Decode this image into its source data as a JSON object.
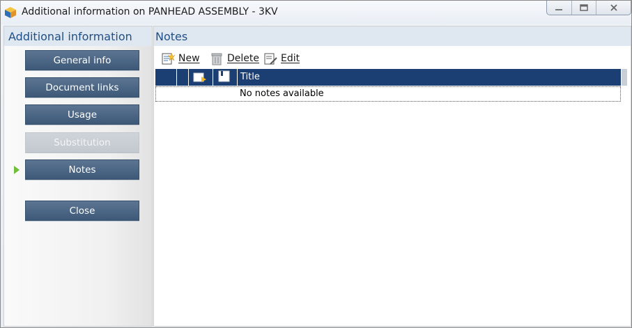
{
  "window": {
    "title": "Additional information on PANHEAD ASSEMBLY - 3KV",
    "caption_buttons": [
      "minimize-icon",
      "maximize-icon",
      "close-icon"
    ]
  },
  "left_panel": {
    "header": "Additional information",
    "buttons": [
      {
        "label": "General info",
        "enabled": true,
        "selected": false
      },
      {
        "label": "Document links",
        "enabled": true,
        "selected": false
      },
      {
        "label": "Usage",
        "enabled": true,
        "selected": false
      },
      {
        "label": "Substitution",
        "enabled": false,
        "selected": false
      },
      {
        "label": "Notes",
        "enabled": true,
        "selected": true
      }
    ],
    "close_label": "Close"
  },
  "right_panel": {
    "header": "Notes",
    "toolbar": {
      "new_label": "New",
      "delete_label": "Delete",
      "edit_label": "Edit"
    },
    "table": {
      "columns": [
        "",
        "",
        "attachment-icon",
        "note-icon",
        "Title"
      ],
      "empty_message": "No notes available"
    }
  },
  "colors": {
    "nav_button": "#4a6684",
    "nav_button_disabled": "#c9cfd5",
    "header_text": "#1f4f86",
    "grid_header": "#1c3f73",
    "selected_arrow": "#6fbf3a"
  }
}
